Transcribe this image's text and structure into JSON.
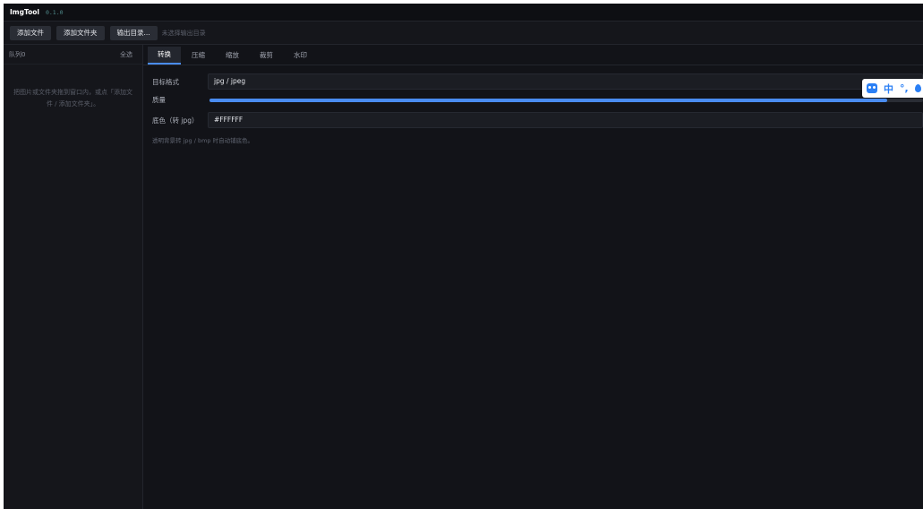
{
  "app": {
    "name": "ImgTool",
    "version": "0.1.0"
  },
  "toolbar": {
    "add_file": "添加文件",
    "add_folder": "添加文件夹",
    "output_dir": "输出目录...",
    "output_status": "未选择输出目录"
  },
  "sidebar": {
    "queue_label": "队列0",
    "select_all": "全选",
    "empty_hint": "把图片或文件夹拖到窗口内，或点「添加文件 / 添加文件夹」。"
  },
  "tabs": [
    {
      "label": "转换",
      "active": true
    },
    {
      "label": "压缩",
      "active": false
    },
    {
      "label": "缩放",
      "active": false
    },
    {
      "label": "裁剪",
      "active": false
    },
    {
      "label": "水印",
      "active": false
    }
  ],
  "convert": {
    "format_label": "目标格式",
    "format_value": "jpg / jpeg",
    "quality_label": "质量",
    "quality_fraction": 0.95,
    "bg_label": "底色（转 jpg）",
    "bg_value": "#FFFFFF",
    "hint": "透明背景转 jpg / bmp 时自动铺底色。"
  },
  "ime": {
    "mode": "中",
    "icons": [
      "ime-logo-icon",
      "punctuation-icon",
      "skin-icon"
    ]
  },
  "colors": {
    "accent": "#4a8cf0",
    "background": "#121318",
    "ime_blue": "#2a7ff5"
  }
}
